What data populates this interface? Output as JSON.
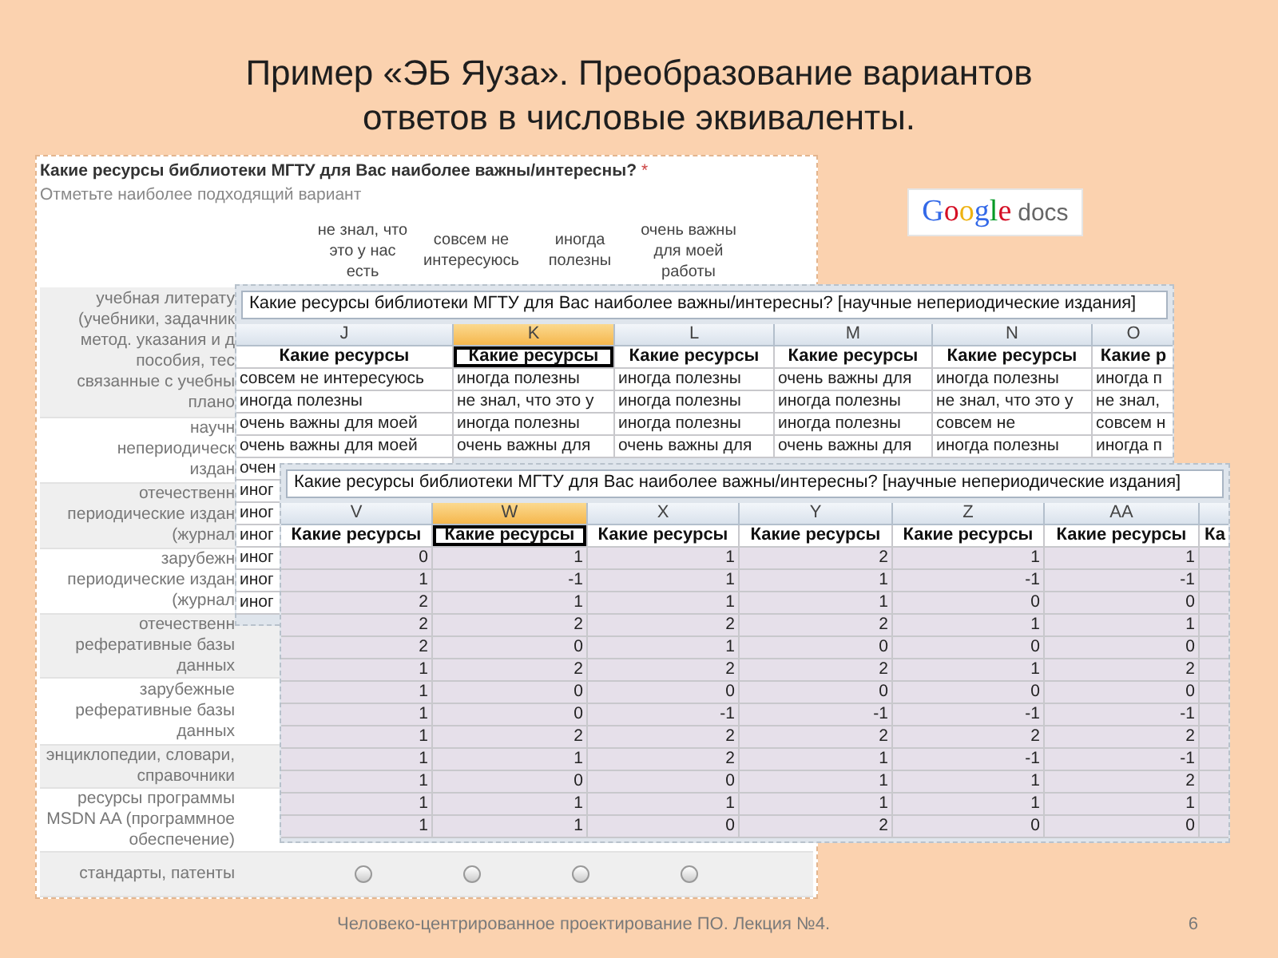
{
  "slide": {
    "title_lines": [
      "Пример «ЭБ Яуза». Преобразование вариантов",
      "ответов в числовые эквиваленты."
    ],
    "footer": "Человеко-центрированное проектирование ПО. Лекция №4.",
    "page_number": "6"
  },
  "logo": {
    "brand": "Google",
    "product": "docs"
  },
  "form": {
    "question": "Какие ресурсы библиотеки МГТУ для Вас наиболее важны/интересны?",
    "required_mark": "*",
    "hint": "Отметьте наиболее подходящий вариант",
    "options": [
      [
        "не знал, что",
        "это у нас",
        "есть"
      ],
      [
        "совсем не",
        "интересуюсь"
      ],
      [
        "иногда",
        "полезны"
      ],
      [
        "очень важны",
        "для моей",
        "работы"
      ]
    ],
    "rows": [
      {
        "kind": "covered",
        "lines": [
          "учебная литерату",
          "(учебники, задачник",
          "метод. указания и д",
          "пособия, тес",
          "связанные с учебны",
          "плано"
        ]
      },
      {
        "kind": "covered",
        "lines": [
          "научн",
          "непериодическ",
          "издан"
        ]
      },
      {
        "kind": "covered",
        "lines": [
          "отечественн",
          "периодические издан",
          "(журнал"
        ]
      },
      {
        "kind": "covered",
        "lines": [
          "зарубежн",
          "периодические издан",
          "(журнал"
        ]
      },
      {
        "kind": "covered",
        "lines": [
          "отечественн",
          "реферативные базы",
          "данных"
        ]
      },
      {
        "kind": "covered",
        "lines": [
          "зарубежные",
          "реферативные базы",
          "данных"
        ]
      },
      {
        "kind": "covered",
        "lines": [
          "энциклопедии, словари,",
          "справочники"
        ]
      },
      {
        "kind": "covered",
        "lines": [
          "ресурсы программы",
          "MSDN AA (программное",
          "обеспечение)"
        ]
      },
      {
        "kind": "radios",
        "lines": [
          "стандарты, патенты"
        ],
        "choices": [
          {
            "selected": false
          },
          {
            "selected": false
          },
          {
            "selected": false
          },
          {
            "selected": false
          }
        ]
      }
    ]
  },
  "sheets": [
    {
      "kind": "text",
      "formula": "Какие ресурсы библиотеки МГТУ для Вас наиболее важны/интересны? [научные непериодические издания]",
      "columns": [
        {
          "letter": "J",
          "selected": false,
          "header": "Какие ресурсы",
          "cells": [
            "совсем не интересуюсь",
            "иногда полезны",
            "очень важны для моей",
            "очень важны для моей",
            "очен",
            "иног",
            "иног",
            "иног",
            "иног",
            "иног",
            "иног"
          ]
        },
        {
          "letter": "K",
          "selected": true,
          "header": "Какие ресурсы",
          "cells": [
            "иногда полезны",
            "не знал, что это у",
            "иногда полезны",
            "очень важны для"
          ]
        },
        {
          "letter": "L",
          "selected": false,
          "header": "Какие ресурсы",
          "cells": [
            "иногда полезны",
            "иногда полезны",
            "иногда полезны",
            "очень важны для"
          ]
        },
        {
          "letter": "M",
          "selected": false,
          "header": "Какие ресурсы",
          "cells": [
            "очень важны для",
            "иногда полезны",
            "иногда полезны",
            "очень важны для"
          ]
        },
        {
          "letter": "N",
          "selected": false,
          "header": "Какие ресурсы",
          "cells": [
            "иногда полезны",
            "не знал, что это у",
            "совсем не",
            "иногда полезны"
          ]
        },
        {
          "letter": "O",
          "selected": false,
          "header": "Какие р",
          "cells": [
            "иногда п",
            "не знал,",
            "совсем н",
            "иногда п"
          ]
        }
      ]
    },
    {
      "kind": "numbers",
      "formula": "Какие ресурсы библиотеки МГТУ для Вас наиболее важны/интересны? [научные непериодические издания]",
      "columns": [
        {
          "letter": "V",
          "selected": false,
          "header": "Какие ресурсы",
          "cells": [
            "0",
            "1",
            "2",
            "2",
            "2",
            "1",
            "1",
            "1",
            "1",
            "1",
            "1",
            "1",
            "1"
          ]
        },
        {
          "letter": "W",
          "selected": true,
          "header": "Какие ресурсы",
          "cells": [
            "1",
            "-1",
            "1",
            "2",
            "0",
            "2",
            "0",
            "0",
            "2",
            "1",
            "0",
            "1",
            "1"
          ]
        },
        {
          "letter": "X",
          "selected": false,
          "header": "Какие ресурсы",
          "cells": [
            "1",
            "1",
            "1",
            "2",
            "1",
            "2",
            "0",
            "-1",
            "2",
            "2",
            "0",
            "1",
            "0"
          ]
        },
        {
          "letter": "Y",
          "selected": false,
          "header": "Какие ресурсы",
          "cells": [
            "2",
            "1",
            "1",
            "2",
            "0",
            "2",
            "0",
            "-1",
            "2",
            "1",
            "1",
            "1",
            "2"
          ]
        },
        {
          "letter": "Z",
          "selected": false,
          "header": "Какие ресурсы",
          "cells": [
            "1",
            "-1",
            "0",
            "1",
            "0",
            "1",
            "0",
            "-1",
            "2",
            "-1",
            "1",
            "1",
            "0"
          ]
        },
        {
          "letter": "AA",
          "selected": false,
          "header": "Какие ресурсы",
          "cells": [
            "1",
            "-1",
            "0",
            "1",
            "0",
            "2",
            "0",
            "-1",
            "2",
            "-1",
            "2",
            "1",
            "0"
          ]
        },
        {
          "selected": false,
          "header": "Ка"
        }
      ]
    }
  ]
}
